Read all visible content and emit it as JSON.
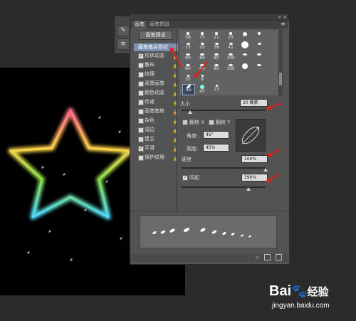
{
  "tool_strip": {
    "icons": [
      "brush-icon",
      "sliders-icon"
    ]
  },
  "panel": {
    "tabs": [
      "画笔",
      "画笔预设"
    ],
    "header_icons": {
      "collapse": "«",
      "close": "×",
      "menu": "≡"
    },
    "presets_button": "画笔预设",
    "sidebar": {
      "selected": "画笔笔尖形状",
      "items": [
        {
          "label": "形状动态",
          "checked": true
        },
        {
          "label": "散布",
          "checked": false
        },
        {
          "label": "纹理",
          "checked": false
        },
        {
          "label": "双重画笔",
          "checked": false
        },
        {
          "label": "颜色动态",
          "checked": false
        },
        {
          "label": "传递",
          "checked": false
        },
        {
          "label": "画笔笔势",
          "checked": false
        },
        {
          "label": "杂色",
          "checked": false
        },
        {
          "label": "湿边",
          "checked": false
        },
        {
          "label": "建立",
          "checked": false
        },
        {
          "label": "平滑",
          "checked": true
        },
        {
          "label": "保护纹理",
          "checked": false
        }
      ]
    },
    "brush_grid": {
      "rows": [
        [
          "58",
          "75",
          "21",
          "25",
          "",
          ""
        ],
        [
          "23",
          "25",
          "36",
          "41",
          "",
          ""
        ],
        [
          "80",
          "80",
          "80",
          "100",
          "",
          ""
        ],
        [
          "80",
          "80",
          "80",
          "100",
          "",
          ""
        ],
        [
          "35",
          "8",
          "",
          "",
          "",
          ""
        ],
        [
          "45",
          "45",
          "13",
          "",
          "",
          ""
        ]
      ]
    },
    "size": {
      "label": "大小",
      "value": "20 像素",
      "fraction": 0.1
    },
    "flip_x": "翻转 X",
    "flip_y": "翻转 Y",
    "angle": {
      "label": "角度:",
      "value": "45°"
    },
    "roundness": {
      "label": "圆度:",
      "value": "45%"
    },
    "hardness": {
      "label": "硬度",
      "value": "100%",
      "fraction": 1.0
    },
    "spacing": {
      "label": "间距",
      "value": "390%",
      "checked": true,
      "fraction": 0.8
    }
  },
  "watermark": {
    "brand": "Bai",
    "brand_suffix": "经验",
    "url": "jingyan.baidu.com"
  },
  "colors": {
    "arrow": "#e02020",
    "selected": "#7b93b3",
    "panel": "#535353"
  }
}
